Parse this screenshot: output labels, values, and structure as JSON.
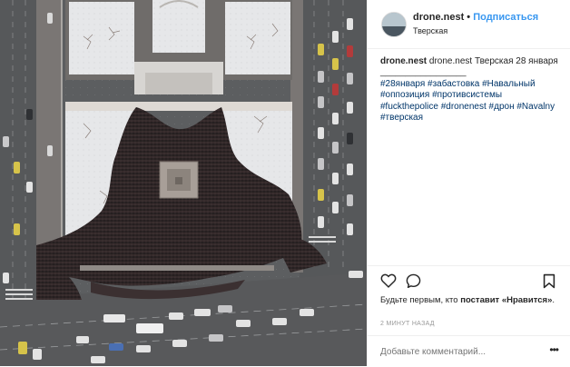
{
  "post": {
    "username": "drone.nest",
    "separator": "•",
    "follow_label": "Подписаться",
    "location": "Тверская",
    "caption": {
      "author": "drone.nest",
      "text": "drone.nest Тверская 28 января",
      "divider": "_________________",
      "hashtags": [
        "#28января",
        "#забастовка",
        "#Навальный",
        "#оппозиция",
        "#противсистемы",
        "#fuckthepolice",
        "#dronenest",
        "#дрон",
        "#Navalny",
        "#тверская"
      ]
    },
    "likes": {
      "prefix": "Будьте первым, кто ",
      "action": "поставит «Нравится»",
      "suffix": "."
    },
    "time_ago": "2 МИНУТ НАЗАД",
    "comment_placeholder": "Добавьте комментарий...",
    "more_label": "•••"
  },
  "icons": {
    "like": "heart-icon",
    "comment": "comment-bubble-icon",
    "save": "bookmark-icon",
    "more": "more-options-icon"
  },
  "colors": {
    "accent": "#3897f0",
    "hashtag": "#003569",
    "muted": "#999999",
    "crowd": "#2a2223",
    "snow": "#e8e8ea",
    "road": "#5e6062"
  }
}
